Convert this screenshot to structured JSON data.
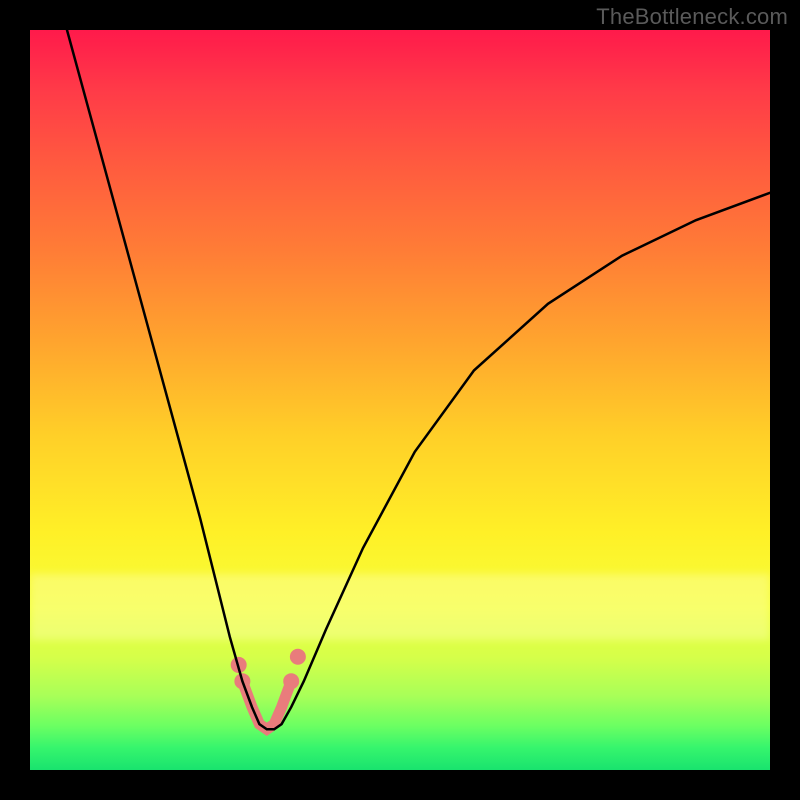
{
  "watermark": "TheBottleneck.com",
  "colors": {
    "salmon": "#e97c7c",
    "black": "#000000",
    "gradient_top": "#ff1a4b",
    "gradient_bottom": "#19e36e"
  },
  "chart_data": {
    "type": "line",
    "title": "",
    "xlabel": "",
    "ylabel": "",
    "xlim": [
      0,
      100
    ],
    "ylim": [
      0,
      100
    ],
    "grid": false,
    "legend": false,
    "series": [
      {
        "name": "bottleneck-curve",
        "color": "#000000",
        "x": [
          5,
          8,
          11,
          14,
          17,
          20,
          23,
          25,
          27,
          28.7,
          30,
          31,
          32,
          33,
          34,
          35.3,
          37,
          40,
          45,
          52,
          60,
          70,
          80,
          90,
          100
        ],
        "y": [
          100,
          89,
          78,
          67,
          56,
          45,
          34,
          26,
          18,
          12,
          8.5,
          6.2,
          5.5,
          5.5,
          6.2,
          8.5,
          12,
          19,
          30,
          43,
          54,
          63,
          69.5,
          74.3,
          78
        ]
      },
      {
        "name": "salmon-u-marker",
        "color": "#e97c7c",
        "x": [
          28.7,
          30,
          31,
          32,
          33,
          34,
          35.3
        ],
        "y": [
          12,
          8.5,
          6.2,
          5.5,
          6.2,
          8.5,
          12
        ]
      }
    ],
    "markers": {
      "name": "salmon-end-dots",
      "color": "#e97c7c",
      "points": [
        {
          "x": 28.7,
          "y": 12
        },
        {
          "x": 35.3,
          "y": 12
        },
        {
          "x": 28.2,
          "y": 14.2
        },
        {
          "x": 36.2,
          "y": 15.3
        }
      ]
    },
    "notes": "Y-axis inverted visually (0 at bottom). The chart shows a V/U‑shaped bottleneck curve on a rainbow gradient with the optimum (minimum) highlighted by a salmon U stroke and dots near the bottom."
  }
}
